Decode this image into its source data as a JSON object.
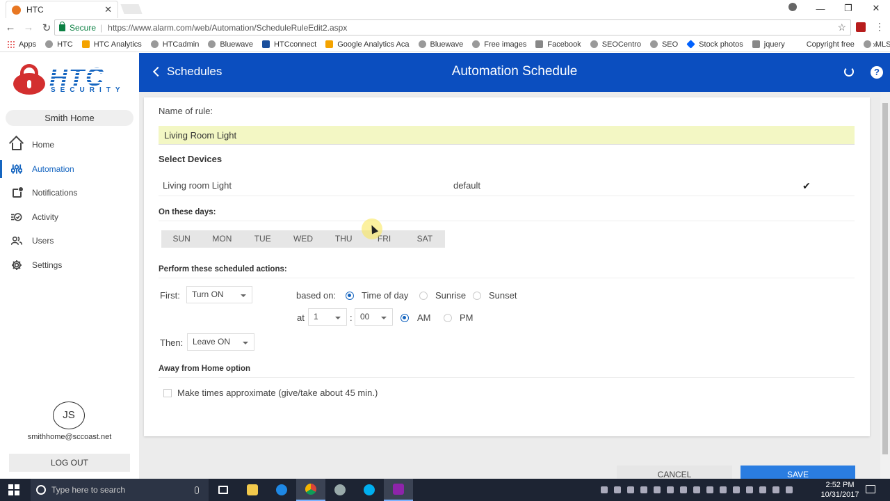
{
  "browser": {
    "tab_title": "HTC",
    "tab_close": "✕",
    "secure_label": "Secure",
    "url_separator": "|",
    "url": "https://www.alarm.com/web/Automation/ScheduleRuleEdit2.aspx",
    "bookmarks": [
      "Apps",
      "HTC",
      "HTC Analytics",
      "HTCadmin",
      "Bluewave",
      "HTCconnect",
      "Google Analytics Aca",
      "Bluewave",
      "Free images",
      "Facebook",
      "SEOCentro",
      "SEO",
      "Stock photos",
      "jquery",
      "Copyright free",
      "MLS"
    ],
    "bookmarks_more": "»"
  },
  "sidebar": {
    "logo_text": "HTC",
    "logo_subtext": "SECURITY",
    "location": "Smith Home",
    "nav": [
      {
        "label": "Home",
        "icon": "home-icon"
      },
      {
        "label": "Automation",
        "icon": "sliders-icon",
        "active": true
      },
      {
        "label": "Notifications",
        "icon": "notification-icon"
      },
      {
        "label": "Activity",
        "icon": "activity-icon"
      },
      {
        "label": "Users",
        "icon": "users-icon"
      },
      {
        "label": "Settings",
        "icon": "gear-icon"
      }
    ],
    "avatar_initials": "JS",
    "email": "smithhome@sccoast.net",
    "logout": "LOG OUT"
  },
  "header": {
    "back_label": "Schedules",
    "title": "Automation Schedule",
    "help": "?",
    "color": "#0b4ebf"
  },
  "form": {
    "name_label": "Name of rule:",
    "name_value": "Living Room Light",
    "devices_heading": "Select Devices",
    "device_name": "Living room Light",
    "device_mode": "default",
    "device_check": "✔",
    "days_heading": "On these days:",
    "days": [
      "SUN",
      "MON",
      "TUE",
      "WED",
      "THU",
      "FRI",
      "SAT"
    ],
    "actions_heading": "Perform these scheduled actions:",
    "first_label": "First:",
    "first_value": "Turn ON",
    "based_on_label": "based on:",
    "based_on_options": [
      "Time of day",
      "Sunrise",
      "Sunset"
    ],
    "based_on_selected": "Time of day",
    "at_label": "at",
    "hour_value": "1",
    "time_colon": ":",
    "minute_value": "00",
    "ampm_options": [
      "AM",
      "PM"
    ],
    "ampm_selected": "AM",
    "then_label": "Then:",
    "then_value": "Leave ON",
    "away_heading": "Away from Home option",
    "approx_label": "Make times approximate (give/take about 45 min.)",
    "approx_checked": false,
    "cancel": "CANCEL",
    "save": "SAVE",
    "save_color": "#2a7de1"
  },
  "taskbar": {
    "search_placeholder": "Type here to search",
    "time": "2:52 PM",
    "date": "10/31/2017"
  }
}
